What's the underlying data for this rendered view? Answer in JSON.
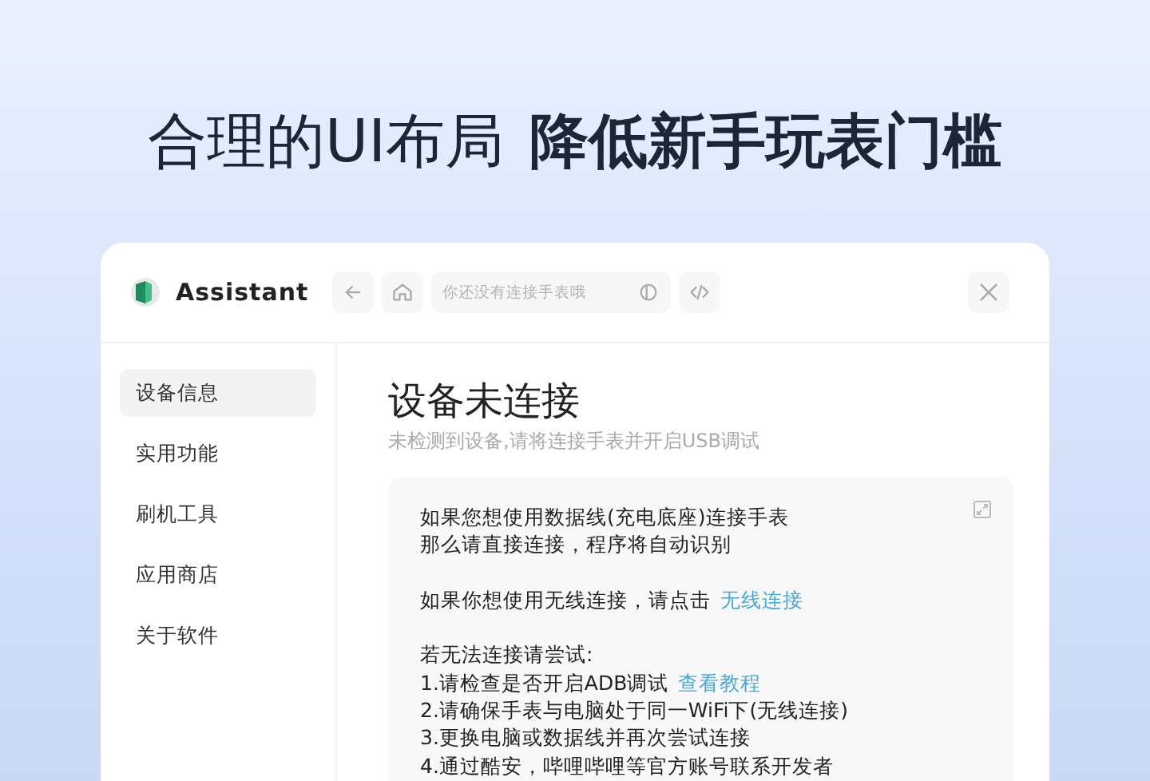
{
  "headline": {
    "lead": "合理的UI布局",
    "emphasis": "降低新手玩表门槛"
  },
  "window": {
    "app_name": "Assistant",
    "address": {
      "placeholder": "你还没有连接手表哦"
    }
  },
  "sidebar": {
    "items": [
      {
        "label": "设备信息",
        "selected": true
      },
      {
        "label": "实用功能",
        "selected": false
      },
      {
        "label": "刷机工具",
        "selected": false
      },
      {
        "label": "应用商店",
        "selected": false
      },
      {
        "label": "关于软件",
        "selected": false
      }
    ]
  },
  "content": {
    "title": "设备未连接",
    "subtitle": "未检测到设备,请将连接手表并开启USB调试",
    "paragraphs": [
      {
        "lines": [
          {
            "text": "如果您想使用数据线(充电底座)连接手表"
          },
          {
            "text": "那么请直接连接，程序将自动识别"
          }
        ]
      },
      {
        "lines": [
          {
            "text": "如果你想使用无线连接，请点击",
            "link": "无线连接"
          }
        ]
      },
      {
        "lines": [
          {
            "text": "若无法连接请尝试:"
          },
          {
            "text": "1.请检查是否开启ADB调试",
            "link": "查看教程"
          },
          {
            "text": "2.请确保手表与电脑处于同一WiFi下(无线连接)"
          },
          {
            "text": "3.更换电脑或数据线并再次尝试连接"
          },
          {
            "text": "4.通过酷安，哔哩哔哩等官方账号联系开发者"
          }
        ]
      }
    ]
  }
}
